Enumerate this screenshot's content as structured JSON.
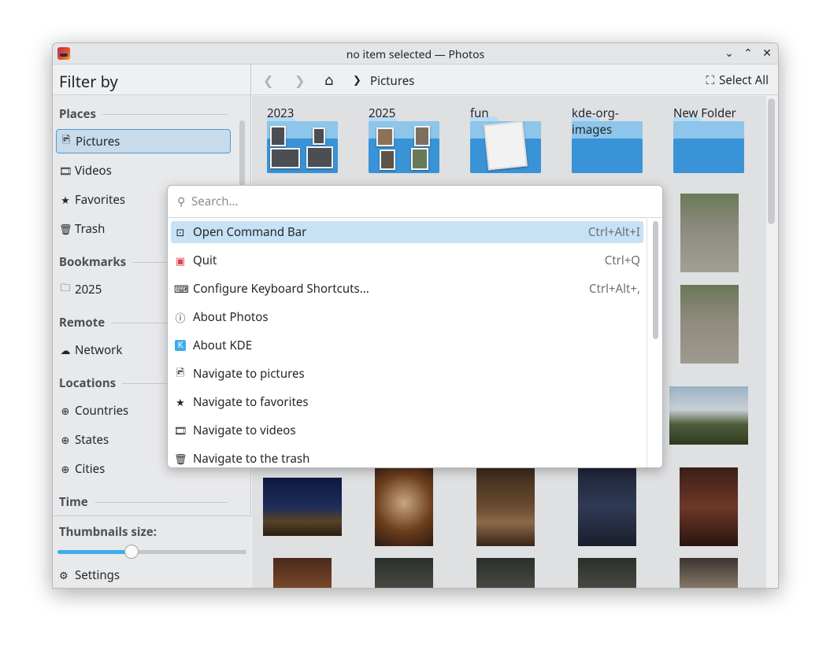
{
  "window": {
    "title": "no item selected — Photos"
  },
  "sidebar": {
    "header": "Filter by",
    "places_title": "Places",
    "places": [
      {
        "label": "Pictures",
        "icon": "image-icon",
        "selected": true
      },
      {
        "label": "Videos",
        "icon": "film-icon"
      },
      {
        "label": "Favorites",
        "icon": "star-icon"
      },
      {
        "label": "Trash",
        "icon": "trash-icon"
      }
    ],
    "bookmarks_title": "Bookmarks",
    "bookmarks": [
      {
        "label": "2025",
        "icon": "folder-icon"
      }
    ],
    "remote_title": "Remote",
    "remote": [
      {
        "label": "Network",
        "icon": "cloud-icon"
      }
    ],
    "locations_title": "Locations",
    "locations": [
      {
        "label": "Countries",
        "icon": "globe-icon"
      },
      {
        "label": "States",
        "icon": "globe-icon"
      },
      {
        "label": "Cities",
        "icon": "globe-icon"
      }
    ],
    "time_title": "Time",
    "thumbnails_label": "Thumbnails size:",
    "thumbnail_size_fraction": 0.39,
    "settings_label": "Settings"
  },
  "toolbar": {
    "breadcrumb": "Pictures",
    "select_all": "Select All"
  },
  "folders": [
    {
      "name": "2023"
    },
    {
      "name": "2025"
    },
    {
      "name": "fun"
    },
    {
      "name": "kde-org-\nimages"
    },
    {
      "name": "New Folder"
    }
  ],
  "command_bar": {
    "search_placeholder": "Search...",
    "items": [
      {
        "label": "Open Command Bar",
        "shortcut": "Ctrl+Alt+I",
        "icon": "terminal-icon",
        "selected": true
      },
      {
        "label": "Quit",
        "shortcut": "Ctrl+Q",
        "icon": "quit-icon"
      },
      {
        "label": "Configure Keyboard Shortcuts...",
        "shortcut": "Ctrl+Alt+,",
        "icon": "keyboard-icon"
      },
      {
        "label": "About Photos",
        "shortcut": "",
        "icon": "info-icon"
      },
      {
        "label": "About KDE",
        "shortcut": "",
        "icon": "kde-icon"
      },
      {
        "label": "Navigate to pictures",
        "shortcut": "",
        "icon": "image-icon"
      },
      {
        "label": "Navigate to favorites",
        "shortcut": "",
        "icon": "star-icon"
      },
      {
        "label": "Navigate to videos",
        "shortcut": "",
        "icon": "film-icon"
      },
      {
        "label": "Navigate to the trash",
        "shortcut": "",
        "icon": "trash-icon"
      }
    ]
  },
  "colors": {
    "accent": "#3daee9",
    "selection": "#c7e2f4",
    "folder_front": "#3993d6",
    "folder_back": "#8ec5ea"
  }
}
